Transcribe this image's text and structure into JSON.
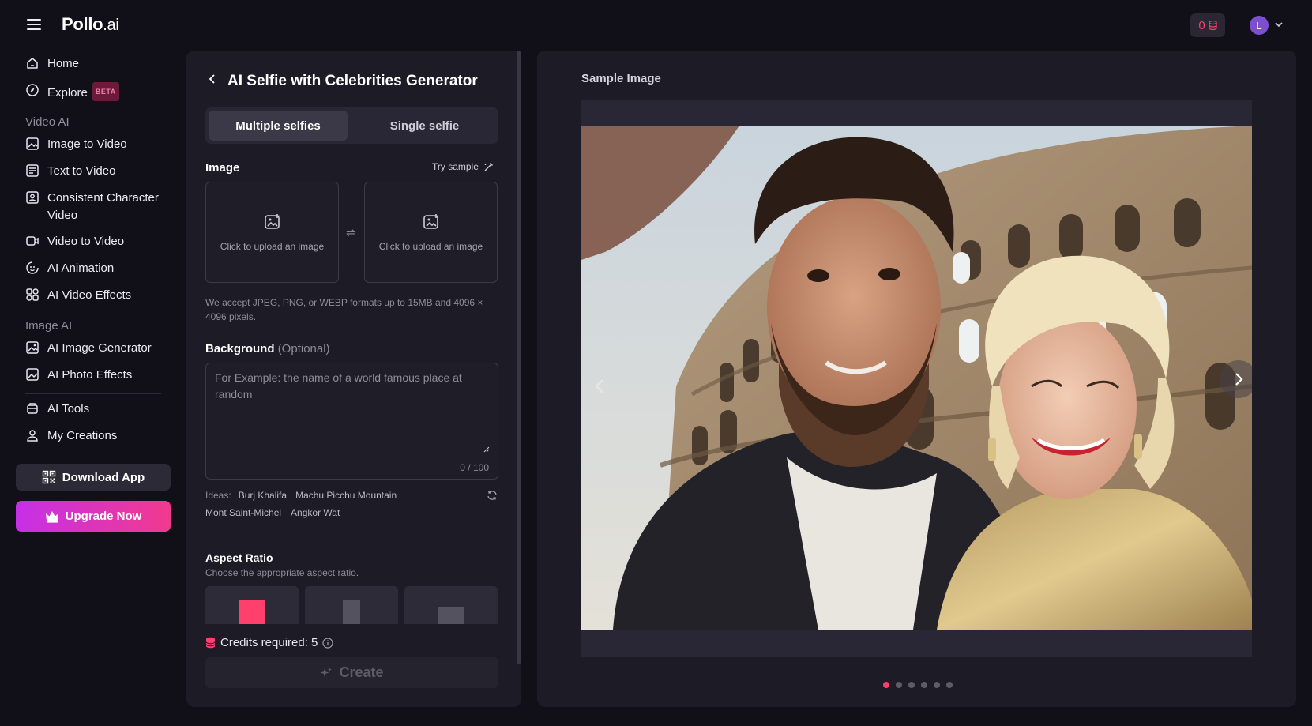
{
  "app": {
    "logo_main": "Pollo",
    "logo_suffix": ".ai",
    "credits_count": "0",
    "avatar_initial": "L"
  },
  "sidebar": {
    "items_top": [
      {
        "label": "Home",
        "icon": "home-icon"
      },
      {
        "label": "Explore",
        "icon": "compass-icon",
        "badge": "BETA"
      }
    ],
    "video_section": "Video AI",
    "video_items": [
      {
        "label": "Image to Video",
        "icon": "image-video-icon"
      },
      {
        "label": "Text to Video",
        "icon": "text-video-icon"
      },
      {
        "label": "Consistent Character Video",
        "icon": "character-video-icon"
      },
      {
        "label": "Video to Video",
        "icon": "video-video-icon"
      },
      {
        "label": "AI Animation",
        "icon": "animation-icon"
      },
      {
        "label": "AI Video Effects",
        "icon": "effects-icon"
      }
    ],
    "image_section": "Image AI",
    "image_items": [
      {
        "label": "AI Image Generator",
        "icon": "image-generator-icon"
      },
      {
        "label": "AI Photo Effects",
        "icon": "photo-effects-icon"
      }
    ],
    "bottom_items": [
      {
        "label": "AI Tools",
        "icon": "tools-icon"
      },
      {
        "label": "My Creations",
        "icon": "creations-icon"
      }
    ],
    "download_label": "Download App",
    "upgrade_label": "Upgrade Now"
  },
  "panel": {
    "title": "AI Selfie with Celebrities Generator",
    "tabs": [
      "Multiple selfies",
      "Single selfie"
    ],
    "active_tab": "Multiple selfies",
    "image_label": "Image",
    "try_sample": "Try sample",
    "upload_text": "Click to upload an image",
    "hint": "We accept JPEG, PNG, or WEBP formats up to 15MB and 4096 × 4096 pixels.",
    "background_label": "Background",
    "background_optional": "(Optional)",
    "background_placeholder": "For Example: the name of a world famous place at random",
    "background_value": "",
    "counter": "0 / 100",
    "ideas_label": "Ideas:",
    "ideas": [
      "Burj Khalifa",
      "Machu Picchu Mountain",
      "Mont Saint-Michel",
      "Angkor Wat"
    ],
    "aspect_label": "Aspect Ratio",
    "aspect_sub": "Choose the appropriate aspect ratio.",
    "credits_label": "Credits required: 5",
    "create_label": "Create"
  },
  "preview": {
    "sample_label": "Sample Image",
    "dot_count": 6,
    "active_dot": 0
  },
  "colors": {
    "accent": "#ff3f6c",
    "upgrade_start": "#c62fe8",
    "upgrade_end": "#f13a8e",
    "panel_bg": "#1d1b26"
  }
}
